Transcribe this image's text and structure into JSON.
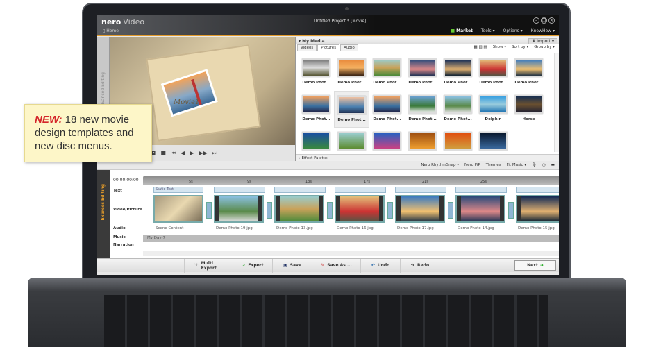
{
  "callout": {
    "new": "NEW:",
    "text": " 18 new movie design templates and new disc menus."
  },
  "app": {
    "logo": "nero",
    "name": "Video",
    "home": "Home",
    "title": "Untitled Project * [Movie]",
    "menu": {
      "market": "Market",
      "tools": "Tools ▾",
      "options": "Options ▾",
      "knowhow": "KnowHow ▾"
    }
  },
  "side": {
    "advanced": "Advanced Editing",
    "express": "Express Editing"
  },
  "preview": {
    "caption": "Movie1"
  },
  "media": {
    "title": "▾ My Media",
    "import": "⬇ Import ▾",
    "tabs": [
      "Videos",
      "Pictures",
      "Audio"
    ],
    "show": "Show ▾",
    "sort": "Sort by ▾",
    "group": "Group by ▾",
    "items": [
      {
        "label": "Demo Phot...",
        "c": "linear-gradient(#777,#ddd 50%,#553)"
      },
      {
        "label": "Demo Phot...",
        "c": "linear-gradient(#e8893b,#f5b060 50%,#3a2414)"
      },
      {
        "label": "Demo Phot...",
        "c": "linear-gradient(#9cc,#c9a25a 50%,#4a8a3a)"
      },
      {
        "label": "Demo Phot...",
        "c": "linear-gradient(#2a4a7a,#d88 60%,#235)"
      },
      {
        "label": "Demo Phot...",
        "c": "linear-gradient(#122a55,#e0b070 60%,#123)"
      },
      {
        "label": "Demo Phot...",
        "c": "linear-gradient(#e3c07a,#c33 60%,#554)"
      },
      {
        "label": "Demo Phot...",
        "c": "linear-gradient(#3a7ac0,#f0c070 60%,#234)"
      },
      {
        "label": "Demo Phot...",
        "c": "linear-gradient(#f0a060,#3a70a0 60%,#224)"
      },
      {
        "label": "Demo Phot...",
        "c": "linear-gradient(#f0c0a0,#4a80b0 60%,#235)"
      },
      {
        "label": "Demo Phot...",
        "c": "linear-gradient(#f0a060,#3a70a0 60%,#224)"
      },
      {
        "label": "Demo Phot...",
        "c": "linear-gradient(#6aa0d0,#3a7a3a 60%,#eee)"
      },
      {
        "label": "Demo Phot...",
        "c": "linear-gradient(#8ac0e0,#5a8a4a 60%,#ddd)"
      },
      {
        "label": "Dolphin",
        "c": "linear-gradient(#3aa0e0,#9cd 50%,#1a70b0)"
      },
      {
        "label": "Horse",
        "c": "linear-gradient(#1a3050,#6a5030 50%,#223)"
      },
      {
        "label": "",
        "c": "linear-gradient(#1a50a0,#3a8a3a)"
      },
      {
        "label": "",
        "c": "linear-gradient(#9cc,#5a8a2a)"
      },
      {
        "label": "",
        "c": "linear-gradient(#2a60c0,#d04080)"
      },
      {
        "label": "",
        "c": "linear-gradient(#a05010,#f0a030)"
      },
      {
        "label": "",
        "c": "linear-gradient(#e05010,#d0a040)"
      },
      {
        "label": "",
        "c": "linear-gradient(#0a1a30,#3a6aa0)"
      }
    ],
    "effect": "▸ Effect Palette:"
  },
  "toolbar": {
    "rhythm": "Nero RhythmSnap ▾",
    "pip": "Nero PiP",
    "themes": "Themes",
    "fit": "Fit Music ▾"
  },
  "timeline": {
    "timecode": "00:00:00:00",
    "ticks": [
      "5s",
      "9s",
      "13s",
      "17s",
      "21s",
      "25s"
    ],
    "rows": [
      "Text",
      "Video/Picture",
      "Audio",
      "Music",
      "Narration"
    ],
    "static_text": "Static Text",
    "music_clip": "My Day-7",
    "clips": [
      {
        "name": "Scene Content",
        "c": "linear-gradient(135deg,#a89a7d,#e9d8b0 50%,#7a6d57)"
      },
      {
        "name": "Demo Photo 19.jpg",
        "c": "linear-gradient(#8ac0e0,#5a8a4a 60%,#ddd)"
      },
      {
        "name": "Demo Photo 13.jpg",
        "c": "linear-gradient(#9cc,#c9a25a 50%,#4a8a3a)"
      },
      {
        "name": "Demo Photo 16.jpg",
        "c": "linear-gradient(#e3c07a,#c33 60%,#554)"
      },
      {
        "name": "Demo Photo 17.jpg",
        "c": "linear-gradient(#3a7ac0,#f0c070 60%,#234)"
      },
      {
        "name": "Demo Photo 14.jpg",
        "c": "linear-gradient(#2a4a7a,#d88 60%,#235)"
      },
      {
        "name": "Demo Photo 15.jpg",
        "c": "linear-gradient(#122a55,#e0b070 60%,#123)"
      }
    ]
  },
  "bottom": {
    "multi": "Multi Export",
    "export": "Export",
    "save": "Save",
    "saveas": "Save As ...",
    "undo": "Undo",
    "redo": "Redo",
    "next": "Next"
  }
}
